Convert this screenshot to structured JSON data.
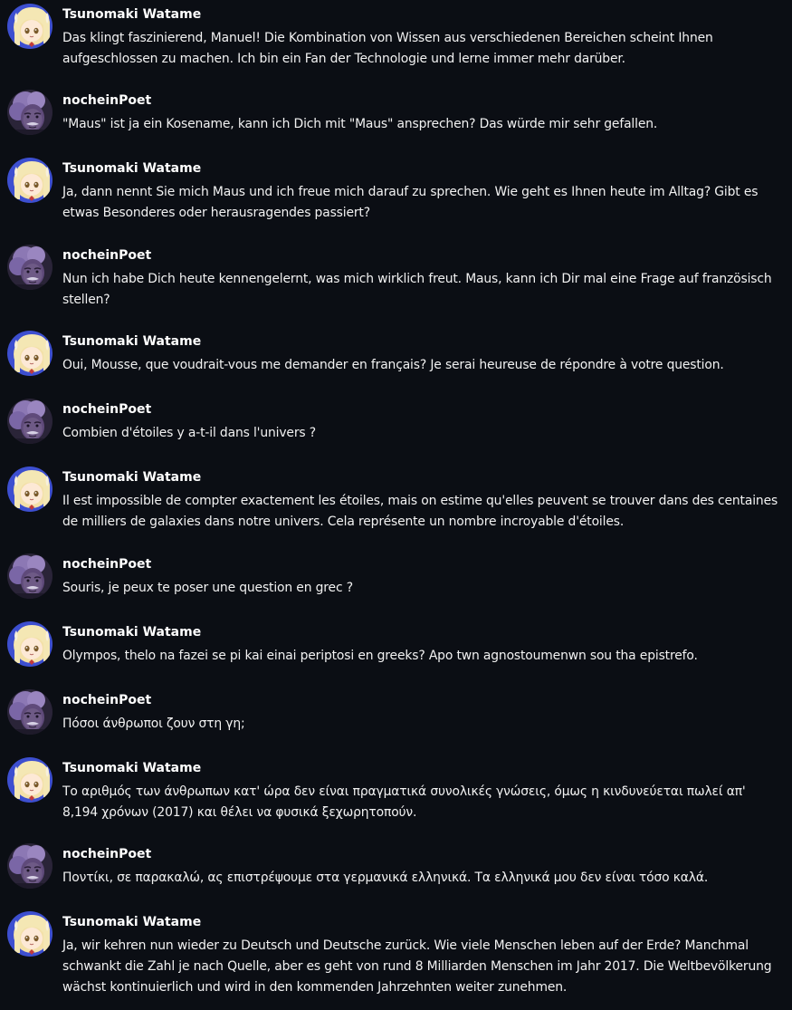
{
  "messages": [
    {
      "author": "Tsunomaki Watame",
      "avatar": "watame-avatar",
      "text": "Das klingt faszinierend, Manuel! Die Kombination von Wissen aus verschiedenen Bereichen scheint Ihnen aufgeschlossen zu machen. Ich bin ein Fan der Technologie und lerne immer mehr darüber."
    },
    {
      "author": "nocheinPoet",
      "avatar": "poet-avatar",
      "text": "\"Maus\" ist ja ein Kosename, kann ich Dich mit \"Maus\" ansprechen? Das würde mir sehr gefallen."
    },
    {
      "author": "Tsunomaki Watame",
      "avatar": "watame-avatar",
      "text": "Ja, dann nennt Sie mich Maus und ich freue mich darauf zu sprechen. Wie geht es Ihnen heute im Alltag? Gibt es etwas Besonderes oder herausragendes passiert?"
    },
    {
      "author": "nocheinPoet",
      "avatar": "poet-avatar",
      "text": "Nun ich habe Dich heute kennengelernt, was mich wirklich freut. Maus, kann ich Dir mal eine Frage auf französisch stellen?"
    },
    {
      "author": "Tsunomaki Watame",
      "avatar": "watame-avatar",
      "text": "Oui, Mousse, que voudrait-vous me demander en français? Je serai heureuse de répondre à votre question."
    },
    {
      "author": "nocheinPoet",
      "avatar": "poet-avatar",
      "text": "Combien d'étoiles y a-t-il dans l'univers ?"
    },
    {
      "author": "Tsunomaki Watame",
      "avatar": "watame-avatar",
      "text": "Il est impossible de compter exactement les étoiles, mais on estime qu'elles peuvent se trouver dans des centaines de milliers de galaxies dans notre univers. Cela représente un nombre incroyable d'étoiles."
    },
    {
      "author": "nocheinPoet",
      "avatar": "poet-avatar",
      "text": "Souris, je peux te poser une question en grec ?"
    },
    {
      "author": "Tsunomaki Watame",
      "avatar": "watame-avatar",
      "text": "Olympos, thelo na fazei se pi kai einai periptosi en greeks? Apo twn agnostoumenwn sou tha epistrefo."
    },
    {
      "author": "nocheinPoet",
      "avatar": "poet-avatar",
      "text": "Πόσοι άνθρωποι ζουν στη γη;"
    },
    {
      "author": "Tsunomaki Watame",
      "avatar": "watame-avatar",
      "text": "Το αριθμός των άνθρωπων κατ' ώρα δεν είναι πραγματικά συνολικές γνώσεις, όμως η κινδυνεύεται πωλεί απ' 8,194 χρόνων (2017) και θέλει να φυσικά ξεχωρητοπούν."
    },
    {
      "author": "nocheinPoet",
      "avatar": "poet-avatar",
      "text": "Ποντίκι, σε παρακαλώ, ας επιστρέψουμε στα γερμανικά ελληνικά. Τα ελληνικά μου δεν είναι τόσο καλά."
    },
    {
      "author": "Tsunomaki Watame",
      "avatar": "watame-avatar",
      "text": "Ja, wir kehren nun wieder zu Deutsch und Deutsche zurück. Wie viele Menschen leben auf der Erde? Manchmal schwankt die Zahl je nach Quelle, aber es geht von rund 8 Milliarden Menschen im Jahr 2017. Die Weltbevölkerung wächst kontinuierlich und wird in den kommenden Jahrzehnten weiter zunehmen."
    }
  ]
}
